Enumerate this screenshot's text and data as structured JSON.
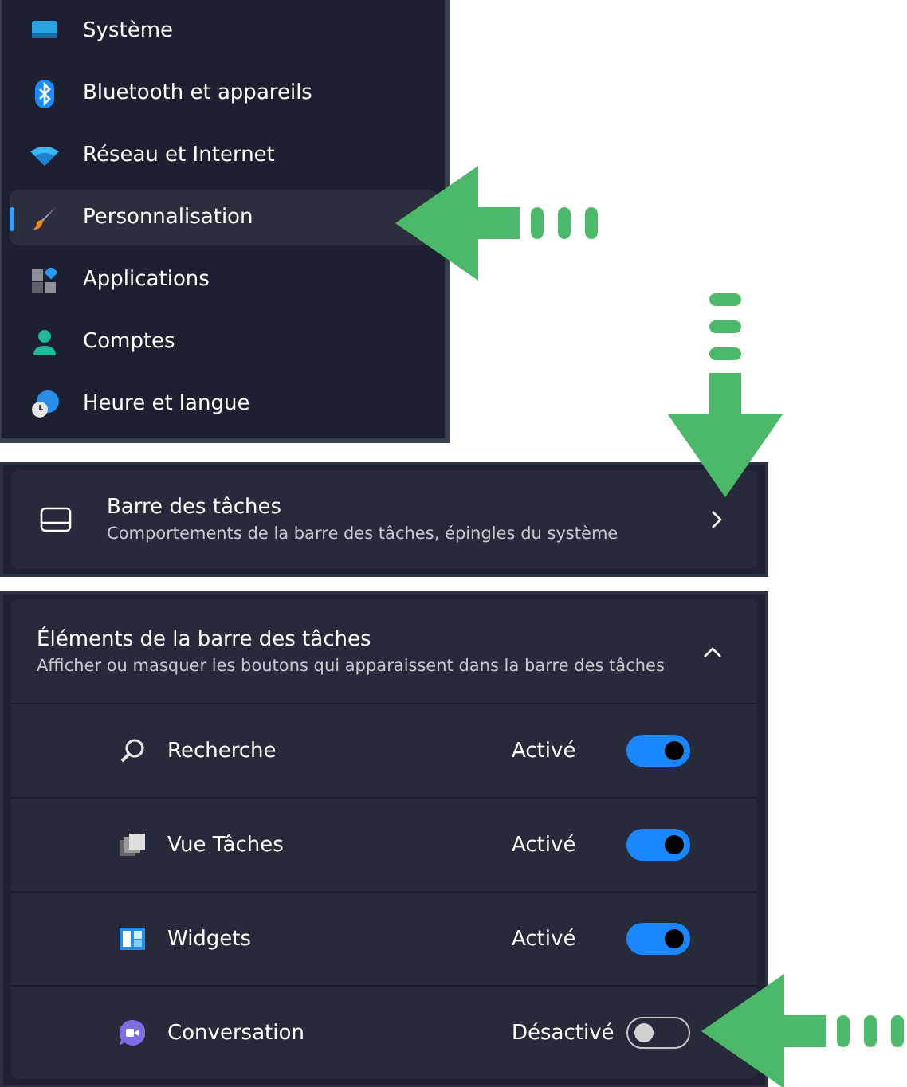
{
  "nav": [
    {
      "label": "Système",
      "selected": false
    },
    {
      "label": "Bluetooth et appareils",
      "selected": false
    },
    {
      "label": "Réseau et Internet",
      "selected": false
    },
    {
      "label": "Personnalisation",
      "selected": true
    },
    {
      "label": "Applications",
      "selected": false
    },
    {
      "label": "Comptes",
      "selected": false
    },
    {
      "label": "Heure et langue",
      "selected": false
    }
  ],
  "taskbar_card": {
    "title": "Barre des tâches",
    "subtitle": "Comportements de la barre des tâches, épingles du système"
  },
  "items_section": {
    "title": "Éléments de la barre des tâches",
    "subtitle": "Afficher ou masquer les boutons qui apparaissent dans la barre des tâches",
    "expanded": true,
    "items": [
      {
        "label": "Recherche",
        "status": "Activé",
        "on": true
      },
      {
        "label": "Vue Tâches",
        "status": "Activé",
        "on": true
      },
      {
        "label": "Widgets",
        "status": "Activé",
        "on": true
      },
      {
        "label": "Conversation",
        "status": "Désactivé",
        "on": false
      }
    ]
  }
}
